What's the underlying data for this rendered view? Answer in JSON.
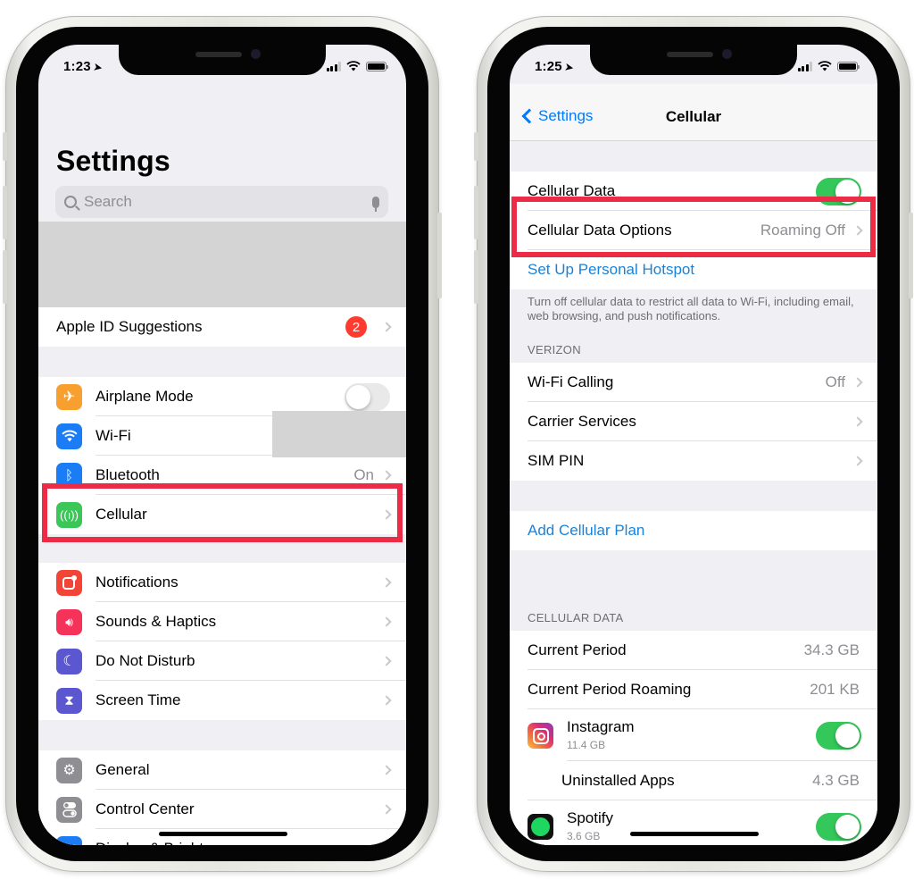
{
  "left_phone": {
    "status": {
      "time": "1:23"
    },
    "title": "Settings",
    "search": {
      "placeholder": "Search"
    },
    "apple_id": {
      "label": "Apple ID Suggestions",
      "badge": "2"
    },
    "group1": [
      {
        "label": "Airplane Mode",
        "icon": "airplane-icon",
        "color": "#f7a030",
        "control": "toggle-off"
      },
      {
        "label": "Wi-Fi",
        "icon": "wifi-icon",
        "color": "#1a7df5",
        "value": ""
      },
      {
        "label": "Bluetooth",
        "icon": "bluetooth-icon",
        "color": "#1a7df5",
        "value": "On"
      },
      {
        "label": "Cellular",
        "icon": "cellular-antenna-icon",
        "color": "#3bc658",
        "value": ""
      }
    ],
    "group2": [
      {
        "label": "Notifications",
        "icon": "notifications-icon",
        "color": "#f24437"
      },
      {
        "label": "Sounds & Haptics",
        "icon": "speaker-icon",
        "color": "#f5325a"
      },
      {
        "label": "Do Not Disturb",
        "icon": "moon-icon",
        "color": "#5b57d1"
      },
      {
        "label": "Screen Time",
        "icon": "hourglass-icon",
        "color": "#5b57d1"
      }
    ],
    "group3": [
      {
        "label": "General",
        "icon": "gear-icon",
        "color": "#8e8e93"
      },
      {
        "label": "Control Center",
        "icon": "switches-icon",
        "color": "#8e8e93"
      },
      {
        "label": "Display & Brightness",
        "icon": "display-icon",
        "color": "#1a7df5"
      }
    ]
  },
  "right_phone": {
    "status": {
      "time": "1:25"
    },
    "nav": {
      "back_label": "Settings",
      "title": "Cellular"
    },
    "cellular_data": {
      "label": "Cellular Data",
      "enabled": true
    },
    "data_options": {
      "label": "Cellular Data Options",
      "value": "Roaming Off"
    },
    "hotspot": {
      "label": "Set Up Personal Hotspot"
    },
    "footer_note": "Turn off cellular data to restrict all data to Wi-Fi, including email, web browsing, and push notifications.",
    "carrier_header": "VERIZON",
    "carrier_rows": [
      {
        "label": "Wi-Fi Calling",
        "value": "Off"
      },
      {
        "label": "Carrier Services",
        "value": ""
      },
      {
        "label": "SIM PIN",
        "value": ""
      }
    ],
    "add_plan": {
      "label": "Add Cellular Plan"
    },
    "usage_header": "CELLULAR DATA",
    "usage_rows": [
      {
        "label": "Current Period",
        "value": "34.3 GB"
      },
      {
        "label": "Current Period Roaming",
        "value": "201 KB"
      }
    ],
    "apps": [
      {
        "name": "Instagram",
        "usage": "11.4 GB",
        "enabled": true
      },
      {
        "name": "Uninstalled Apps",
        "usage": "4.3 GB"
      },
      {
        "name": "Spotify",
        "usage": "3.6 GB",
        "enabled": true
      }
    ]
  },
  "colors": {
    "highlight": "#ec2c47",
    "ios_blue": "#007aff",
    "toggle_on": "#34c759",
    "badge_red": "#ff3b30"
  }
}
